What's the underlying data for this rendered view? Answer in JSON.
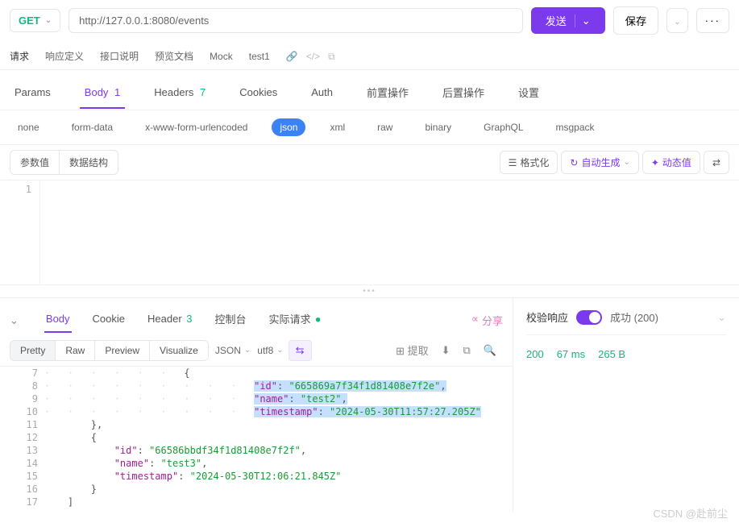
{
  "request": {
    "method": "GET",
    "url": "http://127.0.0.1:8080/events",
    "sendLabel": "发送",
    "saveLabel": "保存"
  },
  "subtabs": [
    "请求",
    "响应定义",
    "接口说明",
    "预览文档",
    "Mock",
    "test1"
  ],
  "maintabs": [
    {
      "label": "Params",
      "count": "",
      "active": false
    },
    {
      "label": "Body",
      "count": "1",
      "active": true
    },
    {
      "label": "Headers",
      "count": "7",
      "countGreen": true
    },
    {
      "label": "Cookies"
    },
    {
      "label": "Auth"
    },
    {
      "label": "前置操作"
    },
    {
      "label": "后置操作"
    },
    {
      "label": "设置"
    }
  ],
  "bodytypes": [
    "none",
    "form-data",
    "x-www-form-urlencoded",
    "json",
    "xml",
    "raw",
    "binary",
    "GraphQL",
    "msgpack"
  ],
  "bodytypeActive": "json",
  "toolbar": {
    "paramValue": "参数值",
    "dataStruct": "数据结构",
    "format": "格式化",
    "autogen": "自动生成",
    "dynamic": "动态值"
  },
  "editor": {
    "lineNum": "1"
  },
  "response": {
    "tabs": [
      {
        "label": "Body",
        "active": true
      },
      {
        "label": "Cookie"
      },
      {
        "label": "Header",
        "count": "3",
        "countGreen": true
      },
      {
        "label": "控制台"
      },
      {
        "label": "实际请求",
        "dot": true
      }
    ],
    "share": "分享",
    "fmtTabs": [
      "Pretty",
      "Raw",
      "Preview",
      "Visualize"
    ],
    "fmtActive": "Pretty",
    "fmtType": "JSON",
    "fmtEnc": "utf8",
    "extract": "提取",
    "lines": [
      {
        "n": 7,
        "indent": 2,
        "txt": "{",
        "hl": false,
        "guides": true
      },
      {
        "n": 8,
        "indent": 3,
        "key": "id",
        "val": "665869a7f34f1d81408e7f2e",
        "comma": true,
        "hl": true,
        "guides": true
      },
      {
        "n": 9,
        "indent": 3,
        "key": "name",
        "val": "test2",
        "comma": true,
        "hl": true,
        "guides": true
      },
      {
        "n": 10,
        "indent": 3,
        "key": "timestamp",
        "val": "2024-05-30T11:57:27.205Z",
        "hl": true,
        "guides": true
      },
      {
        "n": 11,
        "indent": 2,
        "txt": "},",
        "guides": false
      },
      {
        "n": 12,
        "indent": 2,
        "txt": "{"
      },
      {
        "n": 13,
        "indent": 3,
        "key": "id",
        "val": "66586bbdf34f1d81408e7f2f",
        "comma": true
      },
      {
        "n": 14,
        "indent": 3,
        "key": "name",
        "val": "test3",
        "comma": true
      },
      {
        "n": 15,
        "indent": 3,
        "key": "timestamp",
        "val": "2024-05-30T12:06:21.845Z"
      },
      {
        "n": 16,
        "indent": 2,
        "txt": "}"
      },
      {
        "n": 17,
        "indent": 1,
        "txt": "]"
      }
    ]
  },
  "verify": {
    "label": "校验响应",
    "result": "成功 (200)",
    "status": "200",
    "time": "67 ms",
    "size": "265 B"
  },
  "watermark": "CSDN @赴前尘"
}
